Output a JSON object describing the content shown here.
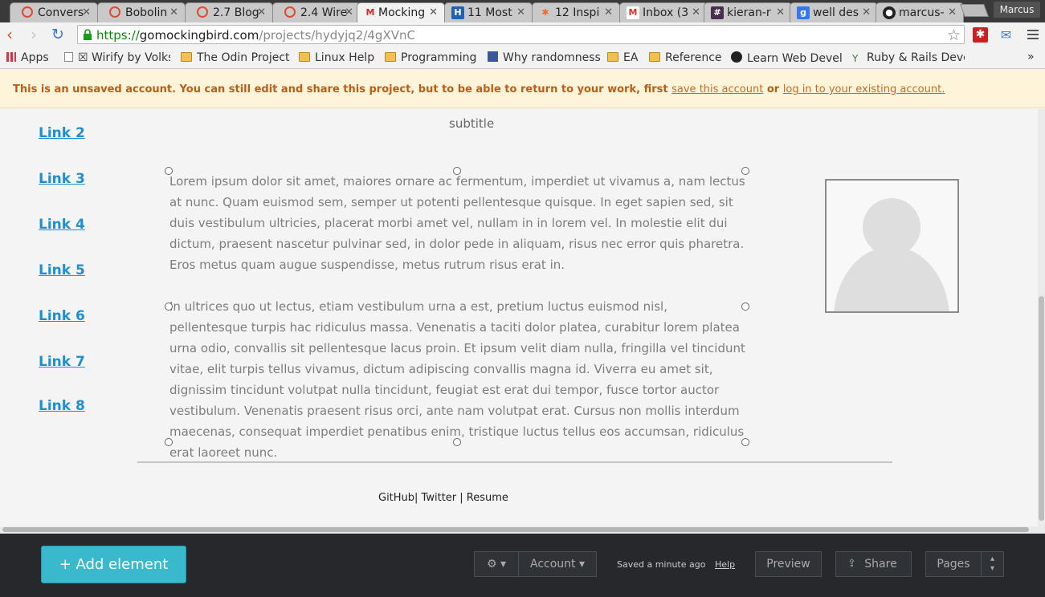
{
  "browser": {
    "tabs": [
      {
        "label": "Convers",
        "icon": "ring-icon",
        "color": "#e04a2e"
      },
      {
        "label": "Bobolin",
        "icon": "ring-icon",
        "color": "#e04a2e"
      },
      {
        "label": "2.7 Blog",
        "icon": "ring-icon",
        "color": "#e04a2e"
      },
      {
        "label": "2.4 Wire",
        "icon": "ring-icon",
        "color": "#e04a2e"
      },
      {
        "label": "Mocking",
        "icon": "mockingbird-icon",
        "color": "#cc2b2b"
      },
      {
        "label": "11 Most",
        "icon": "H",
        "color": "#2262b0"
      },
      {
        "label": "12 Inspi",
        "icon": "flame-icon",
        "color": "#ef6a2b"
      },
      {
        "label": "Inbox (3",
        "icon": "M",
        "color": "#d9382b"
      },
      {
        "label": "kieran-r",
        "icon": "#",
        "color": "#4a2e4e"
      },
      {
        "label": "well des",
        "icon": "g",
        "color": "#3577f0"
      },
      {
        "label": "marcus-",
        "icon": "github-icon",
        "color": "#222222"
      }
    ],
    "user": "Marcus",
    "url": {
      "scheme": "https://",
      "host": "gomockingbird.com",
      "path": "/projects/hydyjq2/4gXVnC"
    },
    "bookmarks": [
      {
        "label": "Apps",
        "icon": "apps-grid-icon"
      },
      {
        "label": "☒ Wirify by Volks",
        "icon": "page-icon"
      },
      {
        "label": "The Odin Project",
        "icon": "folder-icon"
      },
      {
        "label": "Linux Help",
        "icon": "folder-icon"
      },
      {
        "label": "Programming",
        "icon": "folder-icon"
      },
      {
        "label": "Why randomness",
        "icon": "facebook-icon"
      },
      {
        "label": "EA",
        "icon": "folder-icon"
      },
      {
        "label": "Reference",
        "icon": "folder-icon"
      },
      {
        "label": "Learn Web Devel",
        "icon": "owl-icon"
      },
      {
        "label": "Ruby & Rails Deve",
        "icon": "rails-icon"
      }
    ],
    "more": "»"
  },
  "notice": {
    "text": "This is an unsaved account. You can still edit and share this project, but to be able to return to your work, first",
    "save_link": "save this account",
    "or": "or",
    "login_link": "log in to your existing account."
  },
  "mockup": {
    "subtitle": "subtitle",
    "links": [
      "Link 2",
      "Link 3",
      "Link 4",
      "Link 5",
      "Link 6",
      "Link 7",
      "Link 8"
    ],
    "para1": "Lorem ipsum dolor sit amet, maiores ornare ac fermentum, imperdiet ut vivamus a, nam lectus at nunc. Quam euismod sem, semper ut potenti pellentesque quisque. In eget sapien sed, sit duis vestibulum ultricies, placerat morbi amet vel, nullam in in lorem vel. In molestie elit dui dictum, praesent nascetur pulvinar sed, in dolor pede in aliquam, risus nec error quis pharetra. Eros metus quam augue suspendisse, metus rutrum risus erat in.",
    "para2": "In ultrices quo ut lectus, etiam vestibulum urna a est, pretium luctus euismod nisl, pellentesque turpis hac ridiculus massa. Venenatis a taciti dolor platea, curabitur lorem platea urna odio, convallis sit pellentesque lacus proin. Et ipsum velit diam nulla, fringilla vel tincidunt vitae, elit turpis tellus vivamus, dictum adipiscing convallis magna id. Viverra eu amet sit, dignissim tincidunt volutpat nulla tincidunt, feugiat est erat dui tempor, fusce tortor auctor vestibulum. Venenatis praesent risus orci, ante nam volutpat erat. Cursus non mollis interdum maecenas, consequat imperdiet penatibus enim, tristique luctus tellus eos accumsan, ridiculus erat laoreet nunc.",
    "footer": "GitHub| Twitter | Resume"
  },
  "toolbar": {
    "add_element": "+ Add element",
    "settings": "⚙ ▾",
    "account": "Account ▾",
    "saved": "Saved a minute ago",
    "help": "Help",
    "preview": "Preview",
    "share": "Share",
    "pages": "Pages",
    "pages_spinner": "▴\n▾"
  }
}
